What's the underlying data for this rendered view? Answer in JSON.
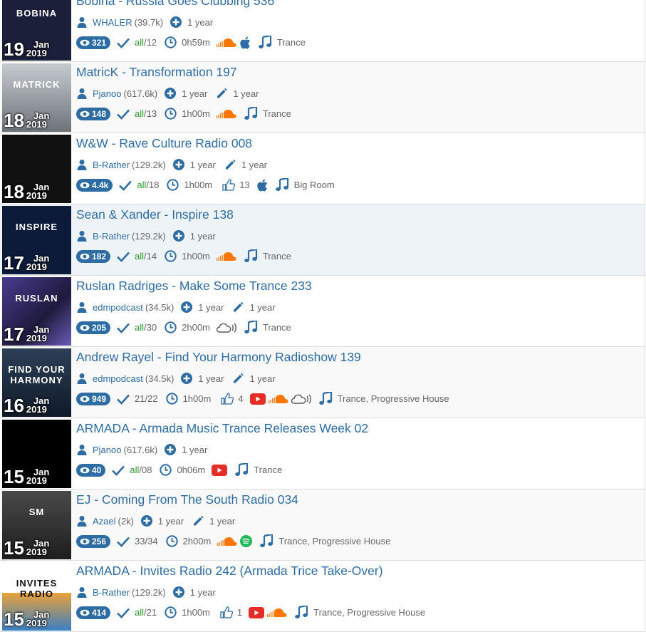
{
  "items": [
    {
      "day": "19",
      "month": "Jan",
      "year": "2019",
      "title": "Bobina - Russia Goes Clubbing 536",
      "user": "WHALER",
      "user_count": "(39.7k)",
      "added": "1 year",
      "edited": "",
      "views": "321",
      "tracks": "/12",
      "tracks_prefix": "all",
      "duration": "0h59m",
      "likes": "",
      "sources": [
        "soundcloud",
        "apple"
      ],
      "genre": "Trance",
      "thumb_text": "BOBINA",
      "thumb_bg": "#1b1f3a"
    },
    {
      "day": "18",
      "month": "Jan",
      "year": "2019",
      "title": "MatricK - Transformation 197",
      "user": "Pjanoo",
      "user_count": "(617.6k)",
      "added": "1 year",
      "edited": "1 year",
      "views": "148",
      "tracks": "/13",
      "tracks_prefix": "all",
      "duration": "1h00m",
      "likes": "",
      "sources": [
        "soundcloud"
      ],
      "genre": "Trance",
      "thumb_text": "MATRICK",
      "thumb_bg": "#9aa1a8"
    },
    {
      "day": "18",
      "month": "Jan",
      "year": "2019",
      "title": "W&W - Rave Culture Radio 008",
      "user": "B-Rather",
      "user_count": "(129.2k)",
      "added": "1 year",
      "edited": "1 year",
      "views": "4.4k",
      "tracks": "/18",
      "tracks_prefix": "all",
      "duration": "1h00m",
      "likes": "13",
      "sources": [
        "apple"
      ],
      "genre": "Big Room",
      "thumb_text": "",
      "thumb_bg": "#111111"
    },
    {
      "day": "17",
      "month": "Jan",
      "year": "2019",
      "title": "Sean & Xander - Inspire 138",
      "user": "B-Rather",
      "user_count": "(129.2k)",
      "added": "1 year",
      "edited": "",
      "views": "182",
      "tracks": "/14",
      "tracks_prefix": "all",
      "duration": "1h00m",
      "likes": "",
      "sources": [
        "soundcloud"
      ],
      "genre": "Trance",
      "thumb_text": "INSPIRE",
      "thumb_bg": "#0c1b3a"
    },
    {
      "day": "17",
      "month": "Jan",
      "year": "2019",
      "title": "Ruslan Radriges - Make Some Trance 233",
      "user": "edmpodcast",
      "user_count": "(34.5k)",
      "added": "1 year",
      "edited": "1 year",
      "views": "205",
      "tracks": "/30",
      "tracks_prefix": "all",
      "duration": "2h00m",
      "likes": "",
      "sources": [
        "cloudcast"
      ],
      "genre": "Trance",
      "thumb_text": "RUSLAN",
      "thumb_bg": "#3b2a6b"
    },
    {
      "day": "16",
      "month": "Jan",
      "year": "2019",
      "title": "Andrew Rayel - Find Your Harmony Radioshow 139",
      "user": "edmpodcast",
      "user_count": "(34.5k)",
      "added": "1 year",
      "edited": "1 year",
      "views": "949",
      "tracks": "21/22",
      "tracks_prefix": "",
      "duration": "1h00m",
      "likes": "4",
      "sources": [
        "youtube",
        "soundcloud",
        "cloudcast"
      ],
      "genre": "Trance, Progressive House",
      "thumb_text": "FIND YOUR HARMONY",
      "thumb_bg": "#1d2e44"
    },
    {
      "day": "15",
      "month": "Jan",
      "year": "2019",
      "title": "ARMADA - Armada Music Trance Releases Week 02",
      "user": "Pjanoo",
      "user_count": "(617.6k)",
      "added": "1 year",
      "edited": "",
      "views": "40",
      "tracks": "/08",
      "tracks_prefix": "all",
      "duration": "0h06m",
      "likes": "",
      "sources": [
        "youtube"
      ],
      "genre": "Trance",
      "thumb_text": "",
      "thumb_bg": "#000000"
    },
    {
      "day": "15",
      "month": "Jan",
      "year": "2019",
      "title": "EJ - Coming From The South Radio 034",
      "user": "Azael",
      "user_count": "(2k)",
      "added": "1 year",
      "edited": "1 year",
      "views": "256",
      "tracks": "33/34",
      "tracks_prefix": "",
      "duration": "2h00m",
      "likes": "",
      "sources": [
        "soundcloud",
        "spotify"
      ],
      "genre": "Trance, Progressive House",
      "thumb_text": "SM",
      "thumb_bg": "#3a3a3a"
    },
    {
      "day": "15",
      "month": "Jan",
      "year": "2019",
      "title": "ARMADA - Invites Radio 242 (Armada Trice Take-Over)",
      "user": "B-Rather",
      "user_count": "(129.2k)",
      "added": "1 year",
      "edited": "",
      "views": "414",
      "tracks": "/21",
      "tracks_prefix": "all",
      "duration": "1h00m",
      "likes": "1",
      "sources": [
        "youtube",
        "soundcloud"
      ],
      "genre": "Trance, Progressive House",
      "thumb_text": "INVITES RADIO",
      "thumb_bg": "#ffffff"
    }
  ],
  "colors": {
    "accent": "#2e6da4",
    "soundcloud": "#ff7700",
    "youtube": "#e52d27",
    "spotify": "#1db954"
  }
}
